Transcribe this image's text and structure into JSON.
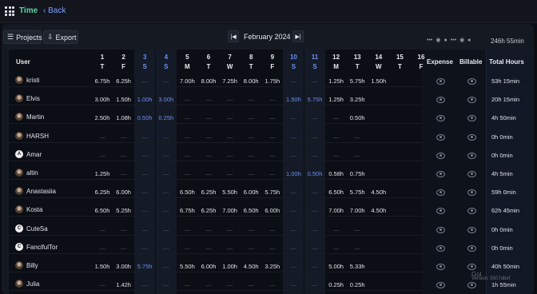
{
  "app": {
    "title": "Time",
    "back_label": "Back"
  },
  "toolbar": {
    "projects_label": "Projects",
    "export_label": "Export",
    "month_label": "February 2024",
    "total_top": "246h 55min",
    "dots": "•••"
  },
  "table": {
    "user_header": "User",
    "columns": [
      {
        "day": "1",
        "wd": "T",
        "weekend": false
      },
      {
        "day": "2",
        "wd": "F",
        "weekend": false
      },
      {
        "day": "3",
        "wd": "S",
        "weekend": true
      },
      {
        "day": "4",
        "wd": "S",
        "weekend": true
      },
      {
        "day": "5",
        "wd": "M",
        "weekend": false
      },
      {
        "day": "6",
        "wd": "T",
        "weekend": false
      },
      {
        "day": "7",
        "wd": "W",
        "weekend": false
      },
      {
        "day": "8",
        "wd": "T",
        "weekend": false
      },
      {
        "day": "9",
        "wd": "F",
        "weekend": false
      },
      {
        "day": "10",
        "wd": "S",
        "weekend": true
      },
      {
        "day": "11",
        "wd": "S",
        "weekend": true
      },
      {
        "day": "12",
        "wd": "M",
        "weekend": false
      },
      {
        "day": "13",
        "wd": "T",
        "weekend": false
      },
      {
        "day": "14",
        "wd": "W",
        "weekend": false
      },
      {
        "day": "15",
        "wd": "T",
        "weekend": false
      },
      {
        "day": "16",
        "wd": "F",
        "weekend": false
      }
    ],
    "expense_header": "Expense",
    "billable_header": "Billable",
    "total_header": "Total Hours",
    "rows": [
      {
        "name": "kristi",
        "avatar": "photo",
        "cells": [
          "6.75h",
          "6.25h",
          "—",
          "—",
          "7.00h",
          "8.00h",
          "7.25h",
          "8.00h",
          "1.75h",
          "—",
          "—",
          "1.25h",
          "5.75h",
          "1.50h",
          "",
          ""
        ],
        "total": "53h 15min"
      },
      {
        "name": "Elvis",
        "avatar": "photo",
        "cells": [
          "3.00h",
          "1.50h",
          "1.00h",
          "3.00h",
          "—",
          "—",
          "—",
          "—",
          "—",
          "1.50h",
          "5.75h",
          "1.25h",
          "3.25h",
          "",
          "",
          ""
        ],
        "total": "20h 15min"
      },
      {
        "name": "Martin",
        "avatar": "photo",
        "cells": [
          "2.50h",
          "1.08h",
          "0.50h",
          "0.25h",
          "—",
          "—",
          "—",
          "—",
          "—",
          "—",
          "—",
          "—",
          "0.50h",
          "",
          "",
          ""
        ],
        "total": "4h 50min"
      },
      {
        "name": "HARSH",
        "avatar": "photo",
        "cells": [
          "—",
          "—",
          "—",
          "—",
          "—",
          "—",
          "—",
          "—",
          "—",
          "—",
          "—",
          "—",
          "—",
          "",
          "",
          ""
        ],
        "total": "0h 0min"
      },
      {
        "name": "Amar",
        "avatar": "A",
        "cells": [
          "—",
          "—",
          "—",
          "—",
          "—",
          "—",
          "—",
          "—",
          "—",
          "—",
          "—",
          "—",
          "—",
          "",
          "",
          ""
        ],
        "total": "0h 0min"
      },
      {
        "name": "altin",
        "avatar": "photo",
        "cells": [
          "1.25h",
          "—",
          "—",
          "—",
          "—",
          "—",
          "—",
          "—",
          "—",
          "1.00h",
          "0.50h",
          "0.58h",
          "0.75h",
          "",
          "",
          ""
        ],
        "total": "4h 5min"
      },
      {
        "name": "Anastasiia",
        "avatar": "photo",
        "cells": [
          "6.25h",
          "6.00h",
          "—",
          "—",
          "6.50h",
          "6.25h",
          "5.50h",
          "6.00h",
          "5.75h",
          "—",
          "—",
          "6.50h",
          "5.75h",
          "4.50h",
          "",
          ""
        ],
        "total": "59h 0min"
      },
      {
        "name": "Kosta",
        "avatar": "photo",
        "cells": [
          "6.50h",
          "5.25h",
          "—",
          "—",
          "6.75h",
          "6.25h",
          "7.00h",
          "6.50h",
          "6.00h",
          "—",
          "—",
          "7.00h",
          "7.00h",
          "4.50h",
          "",
          ""
        ],
        "total": "62h 45min"
      },
      {
        "name": "CuteSa",
        "avatar": "C",
        "cells": [
          "—",
          "—",
          "—",
          "—",
          "—",
          "—",
          "—",
          "—",
          "—",
          "—",
          "—",
          "—",
          "—",
          "",
          "",
          ""
        ],
        "total": "0h 0min"
      },
      {
        "name": "FancifulTor",
        "avatar": "C",
        "cells": [
          "—",
          "—",
          "—",
          "—",
          "—",
          "—",
          "—",
          "—",
          "—",
          "—",
          "—",
          "—",
          "—",
          "",
          "",
          ""
        ],
        "total": "0h 0min"
      },
      {
        "name": "Billy",
        "avatar": "photo",
        "cells": [
          "1.50h",
          "3.00h",
          "5.75h",
          "—",
          "5.50h",
          "6.00h",
          "1.00h",
          "4.50h",
          "3.25h",
          "—",
          "—",
          "5.00h",
          "5.33h",
          "",
          "",
          ""
        ],
        "total": "40h 50min"
      },
      {
        "name": "Julia",
        "avatar": "photo",
        "cells": [
          "—",
          "1.42h",
          "—",
          "—",
          "—",
          "—",
          "—",
          "—",
          "—",
          "—",
          "—",
          "0.25h",
          "0.25h",
          "",
          "",
          ""
        ],
        "total": "1h 55min"
      }
    ]
  },
  "watermark": {
    "brand": "Gol",
    "version": "Version: 5507dbef"
  },
  "colors": {
    "accent_green": "#5fd2a8",
    "weekend_blue": "#6f8ff0",
    "background": "#0b0d12"
  }
}
